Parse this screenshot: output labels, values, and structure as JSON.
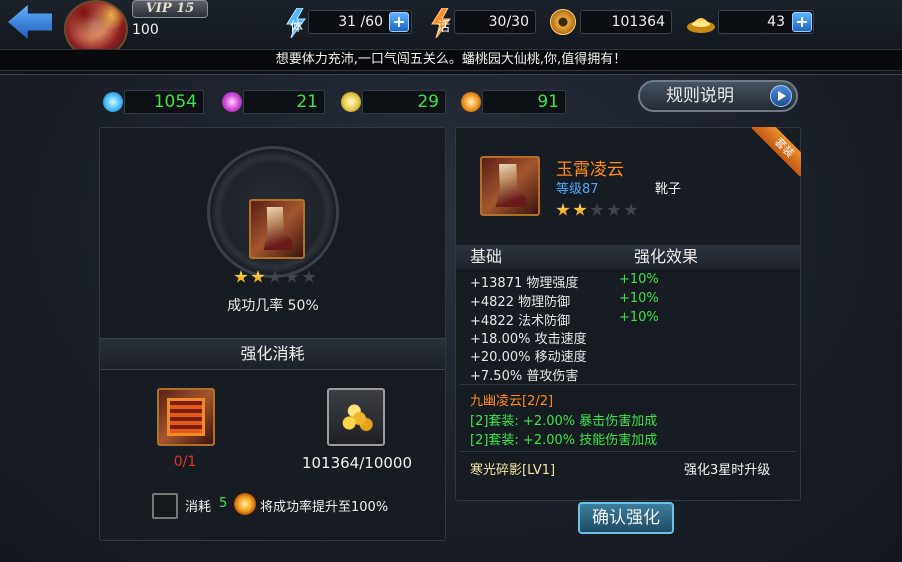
{
  "player": {
    "vip": "VIP 15",
    "level": "100"
  },
  "resources": {
    "stamina_label": "体",
    "stamina_value": "31 /60",
    "vitality_label": "活",
    "vitality_value": "30/30",
    "copper_value": "101364",
    "ingot_value": "43",
    "plus": "+"
  },
  "marquee": "想要体力充沛,一口气闯五关么。蟠桃园大仙桃,你,值得拥有！",
  "currencies": [
    "1054",
    "21",
    "29",
    "91"
  ],
  "rules_button": "规则说明",
  "left": {
    "success_rate": "成功几率 50%",
    "cost_title": "强化消耗",
    "material_count": "0/1",
    "gold_count": "101364/10000",
    "consume_label": "消耗",
    "consume_num": "5",
    "consume_desc": "将成功率提升至100%",
    "stars": [
      true,
      true,
      false,
      false,
      false
    ]
  },
  "right": {
    "ribbon": "套装",
    "name": "玉霄凌云",
    "level": "等级87",
    "type": "靴子",
    "stars": [
      true,
      true,
      false,
      false,
      false
    ],
    "base_title": "基础",
    "effect_title": "强化效果",
    "stats": [
      {
        "text": "+13871 物理强度",
        "bonus": "+10%"
      },
      {
        "text": "+4822 物理防御",
        "bonus": "+10%"
      },
      {
        "text": "+4822 法术防御",
        "bonus": "+10%"
      },
      {
        "text": "+18.00% 攻击速度",
        "bonus": ""
      },
      {
        "text": "+20.00% 移动速度",
        "bonus": ""
      },
      {
        "text": "+7.50% 普攻伤害",
        "bonus": ""
      }
    ],
    "set_name": "九幽凌云[2/2]",
    "set_lines": [
      "[2]套装: +2.00% 暴击伤害加成",
      "[2]套装: +2.00% 技能伤害加成"
    ],
    "skill_name": "寒光碎影[LV1]",
    "skill_note": "强化3星时升级"
  },
  "confirm_button": "确认强化",
  "colors": {
    "green": "#3ee24a",
    "orange": "#ff8a1f",
    "blue": "#4aa8ff",
    "red": "#e0352b"
  },
  "icons": {
    "back": "back-arrow-icon",
    "stamina": "lightning-icon",
    "vitality": "flame-bolt-icon",
    "copper": "copper-coin-icon",
    "ingot": "gold-ingot-icon",
    "currency_1": "blue-crystal-icon",
    "currency_2": "purple-crystal-icon",
    "currency_3": "gold-crystal-icon",
    "currency_4": "fire-crystal-icon"
  }
}
